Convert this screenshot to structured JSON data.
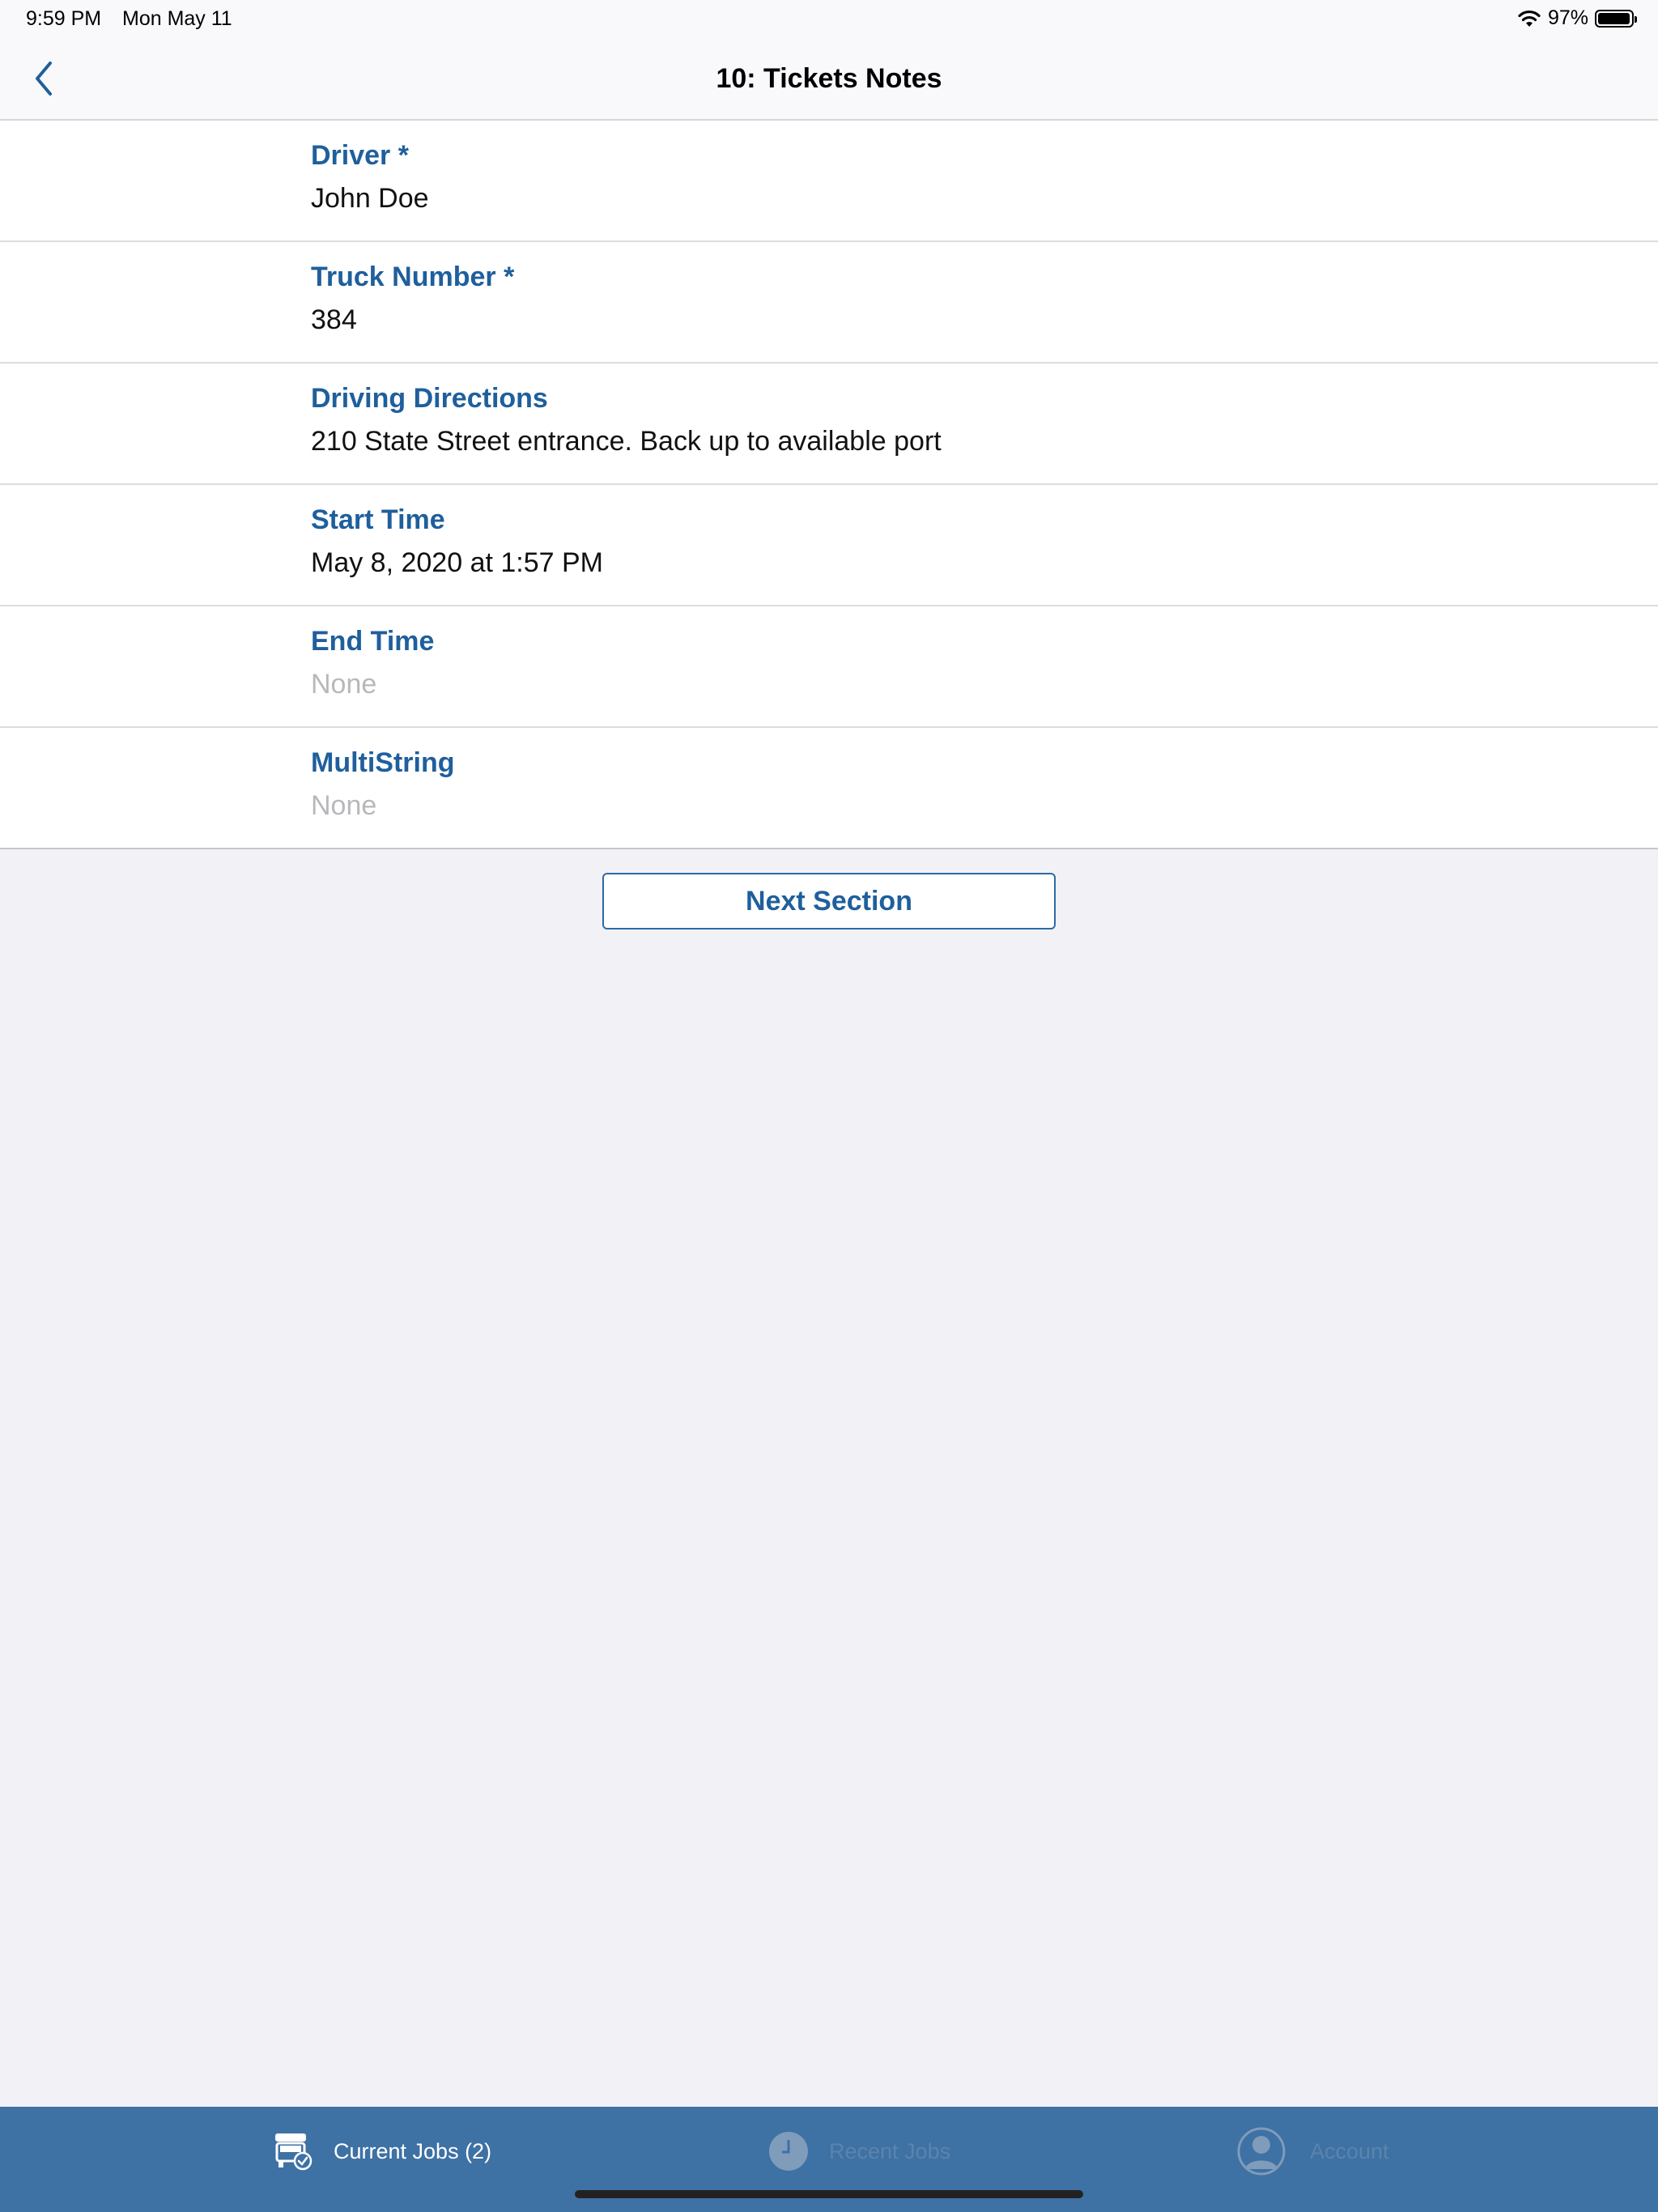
{
  "status_bar": {
    "time": "9:59 PM",
    "date": "Mon May 11",
    "battery_percent": "97%",
    "battery_level": 0.97
  },
  "nav": {
    "title": "10: Tickets Notes",
    "back_icon": "chevron-left-icon"
  },
  "fields": [
    {
      "label": "Driver *",
      "value": "John Doe",
      "is_placeholder": false
    },
    {
      "label": "Truck Number *",
      "value": "384",
      "is_placeholder": false
    },
    {
      "label": "Driving Directions",
      "value": "210 State Street entrance. Back up to available port",
      "is_placeholder": false
    },
    {
      "label": "Start Time",
      "value": "May 8, 2020 at 1:57 PM",
      "is_placeholder": false
    },
    {
      "label": "End Time",
      "value": "None",
      "is_placeholder": true
    },
    {
      "label": "MultiString",
      "value": "None",
      "is_placeholder": true
    }
  ],
  "next_button": {
    "label": "Next Section"
  },
  "tabs": [
    {
      "label": "Current Jobs (2)",
      "icon": "truck-check-icon",
      "active": true
    },
    {
      "label": "Recent Jobs",
      "icon": "clock-icon",
      "active": false
    },
    {
      "label": "Account",
      "icon": "person-icon",
      "active": false
    }
  ],
  "colors": {
    "accent": "#1f5f9c",
    "tab_bar": "#3e71a4",
    "background": "#f1f1f6",
    "placeholder": "#b8b8bc"
  }
}
